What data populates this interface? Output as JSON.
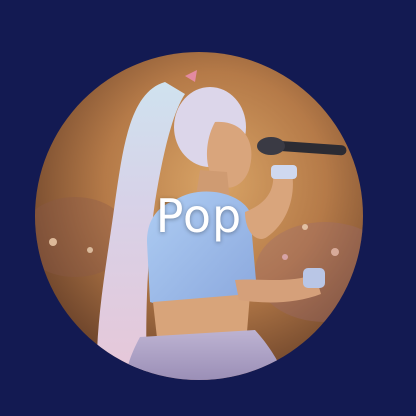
{
  "genre_tile": {
    "label": "Pop",
    "icon": "performer-photo",
    "colors": {
      "page_background": "#131a52",
      "label_text": "#ffffff",
      "photo_warm": "#c98f56",
      "photo_dark": "#5a3422",
      "top_lavender": "#b7b0c8",
      "hair": "#d8d4e6",
      "skin": "#d9a57c",
      "blue_outfit": "#98b6e2"
    }
  }
}
